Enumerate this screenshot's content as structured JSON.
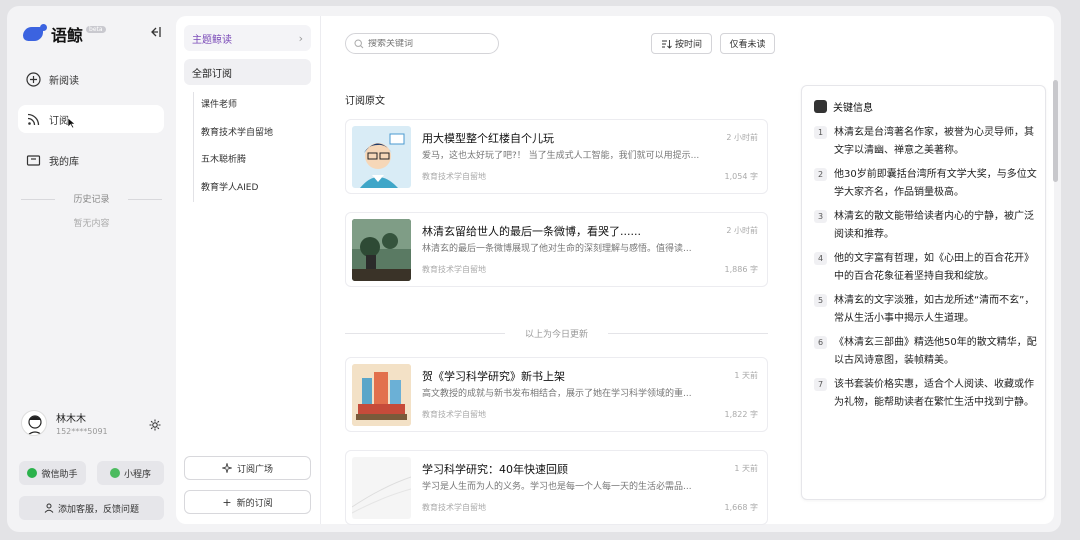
{
  "app": {
    "name": "语鲸",
    "badge": "beta"
  },
  "nav": {
    "new_read": "新阅读",
    "subscribe": "订阅",
    "library": "我的库"
  },
  "history": {
    "title": "历史记录",
    "empty": "暂无内容"
  },
  "user": {
    "name": "林木木",
    "phone": "152****5091"
  },
  "buttons": {
    "wechat": "微信助手",
    "miniprogram": "小程序",
    "service": "添加客服，反馈问题"
  },
  "subpanel": {
    "theme": "主题鲸读",
    "all": "全部订阅",
    "subs": [
      "课件老师",
      "教育技术学自留地",
      "五木聪析腾",
      "教育学人AIED"
    ],
    "square": "订阅广场",
    "new_sub": "新的订阅"
  },
  "main": {
    "search_placeholder": "搜索关键词",
    "sort_time": "按时间",
    "unread_only": "仅看未读",
    "section_title": "订阅原文",
    "divider": "以上为今日更新",
    "cards": [
      {
        "title": "用大模型整个红楼自个儿玩",
        "time": "2 小时前",
        "desc": "爱马，这也太好玩了吧?！ 当了生成式人工智能，我们就可以用提示...",
        "source": "教育技术学自留地",
        "words": "1,054 字"
      },
      {
        "title": "林清玄留给世人的最后一条微博，看哭了......",
        "time": "2 小时前",
        "desc": "林清玄的最后一条微博展现了他对生命的深刻理解与感悟。值得读...",
        "source": "教育技术学自留地",
        "words": "1,886 字"
      },
      {
        "title": "贺《学习科学研究》新书上架",
        "time": "1 天前",
        "desc": "高文教授的成就与新书发布相结合，展示了她在学习科学领域的重...",
        "source": "教育技术学自留地",
        "words": "1,822 字"
      },
      {
        "title": "学习科学研究：40年快速回顾",
        "time": "1 天前",
        "desc": "学习是人生而为人的义务。学习也是每一个人每一天的生活必需品...",
        "source": "教育技术学自留地",
        "words": "1,668 字"
      }
    ]
  },
  "key_info": {
    "title": "关键信息",
    "items": [
      "林清玄是台湾著名作家，被誉为心灵导师，其文字以清幽、禅意之美著称。",
      "他30岁前即囊括台湾所有文学大奖，与多位文学大家齐名，作品销量极高。",
      "林清玄的散文能带给读者内心的宁静，被广泛阅读和推荐。",
      "他的文字富有哲理，如《心田上的百合花开》中的百合花象征着坚持自我和绽放。",
      "林清玄的文字淡雅，如古龙所述“清而不玄”，常从生活小事中揭示人生道理。",
      "《林清玄三部曲》精选他50年的散文精华，配以古风诗意图，装帧精美。",
      "该书套装价格实惠，适合个人阅读、收藏或作为礼物，能帮助读者在繁忙生活中找到宁静。"
    ]
  },
  "colors": {
    "accent": "#3b63e0",
    "theme_text": "#7a4ab8",
    "wechat": "#2bb24c",
    "miniprogram": "#4cbb5f"
  }
}
